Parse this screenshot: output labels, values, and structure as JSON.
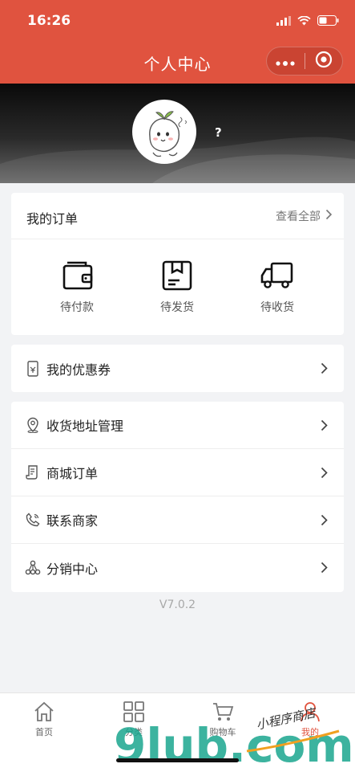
{
  "status_bar": {
    "time": "16:26"
  },
  "nav": {
    "title": "个人中心"
  },
  "profile": {
    "nickname": "?"
  },
  "orders": {
    "title": "我的订单",
    "view_all": "查看全部",
    "statuses": [
      {
        "label": "待付款",
        "icon": "wallet-icon"
      },
      {
        "label": "待发货",
        "icon": "package-icon"
      },
      {
        "label": "待收货",
        "icon": "truck-icon"
      }
    ]
  },
  "menu_top": [
    {
      "label": "我的优惠券",
      "icon": "coupon-icon"
    }
  ],
  "menu": [
    {
      "label": "收货地址管理",
      "icon": "location-pin-icon"
    },
    {
      "label": "商城订单",
      "icon": "order-list-icon"
    },
    {
      "label": "联系商家",
      "icon": "phone-icon"
    },
    {
      "label": "分销中心",
      "icon": "network-icon"
    }
  ],
  "version": "V7.0.2",
  "tabbar": {
    "items": [
      {
        "label": "首页",
        "icon": "home-icon",
        "active": false
      },
      {
        "label": "分类",
        "icon": "grid-icon",
        "active": false
      },
      {
        "label": "购物车",
        "icon": "cart-icon",
        "active": false
      },
      {
        "label": "我的",
        "icon": "user-icon",
        "active": true
      }
    ]
  },
  "watermark": {
    "text": "9lub.com",
    "tagline": "小程序商店"
  },
  "colors": {
    "brand": "#e0533f",
    "background": "#f2f3f5"
  }
}
